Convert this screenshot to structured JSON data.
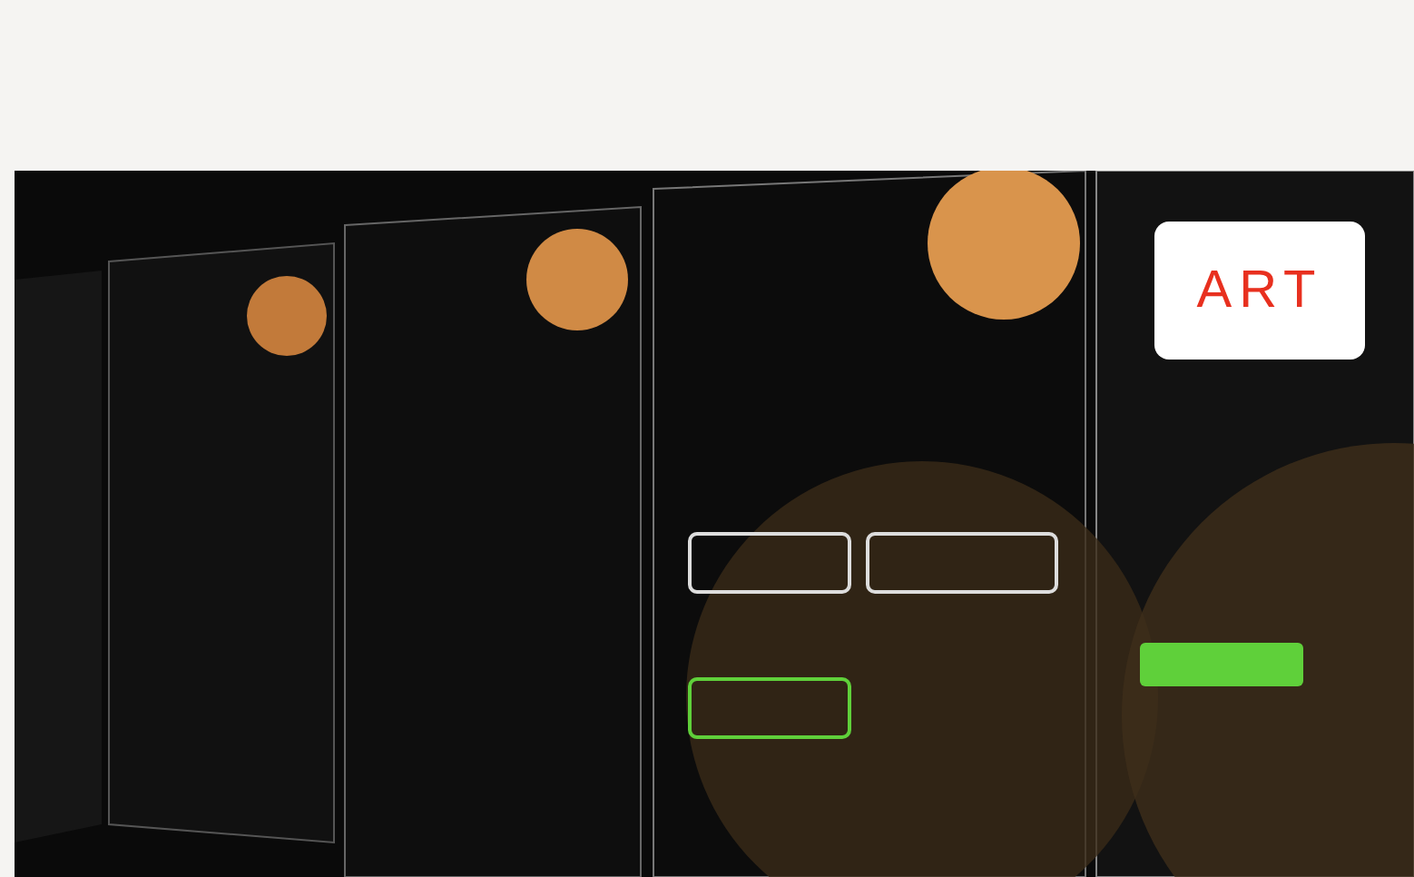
{
  "article": {
    "badge": "ART"
  }
}
